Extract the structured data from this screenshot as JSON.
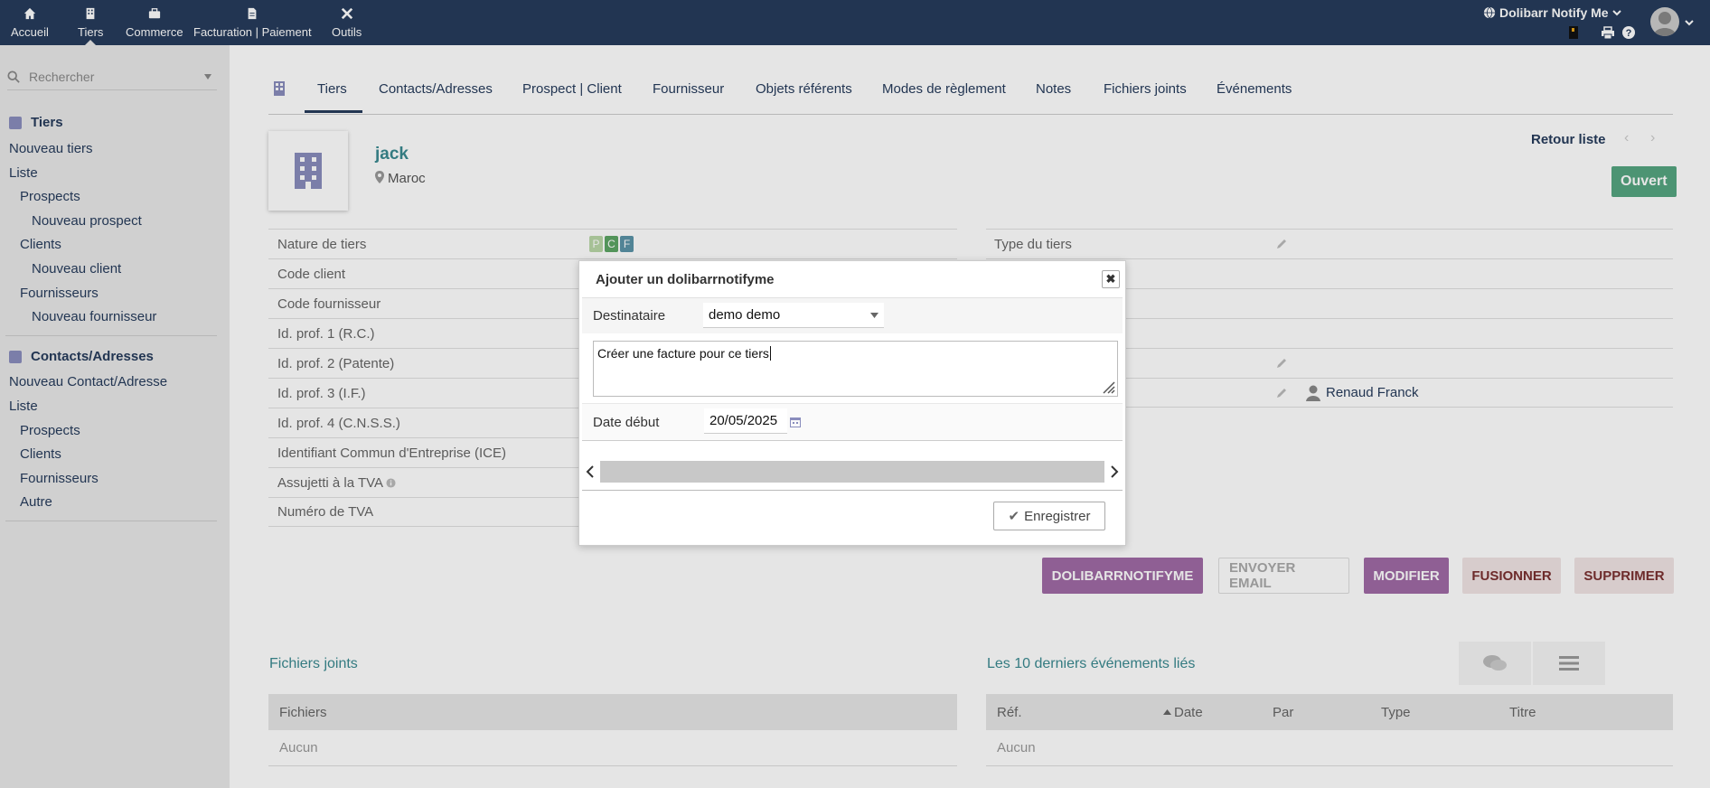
{
  "topnav": {
    "items": [
      {
        "label": "Accueil",
        "icon": "home-icon"
      },
      {
        "label": "Tiers",
        "icon": "building-icon"
      },
      {
        "label": "Commerce",
        "icon": "briefcase-icon"
      },
      {
        "label": "Facturation | Paiement",
        "icon": "invoice-icon"
      },
      {
        "label": "Outils",
        "icon": "tools-icon"
      }
    ],
    "brand": "Dolibarr Notify Me",
    "icons": [
      "notebook-icon",
      "print-icon",
      "help-icon",
      "chevron-down-icon"
    ]
  },
  "sidebar": {
    "search_placeholder": "Rechercher",
    "section1": "Tiers",
    "section1_items": [
      "Nouveau tiers",
      "Liste",
      "Prospects",
      "Nouveau prospect",
      "Clients",
      "Nouveau client",
      "Fournisseurs",
      "Nouveau fournisseur"
    ],
    "section2": "Contacts/Adresses",
    "section2_items": [
      "Nouveau Contact/Adresse",
      "Liste",
      "Prospects",
      "Clients",
      "Fournisseurs",
      "Autre"
    ]
  },
  "tabs": [
    "Tiers",
    "Contacts/Adresses",
    "Prospect | Client",
    "Fournisseur",
    "Objets référents",
    "Modes de règlement",
    "Notes",
    "Fichiers joints",
    "Événements"
  ],
  "company": {
    "name": "jack",
    "country": "Maroc",
    "back_link": "Retour liste",
    "status": "Ouvert"
  },
  "fields_left": [
    "Nature de tiers",
    "Code client",
    "Code fournisseur",
    "Id. prof. 1 (R.C.)",
    "Id. prof. 2 (Patente)",
    "Id. prof. 3 (I.F.)",
    "Id. prof. 4 (C.N.S.S.)",
    "Identifiant Commun d'Entreprise (ICE)",
    "Assujetti à la TVA",
    "Numéro de TVA"
  ],
  "nature_badges": [
    "P",
    "C",
    "F"
  ],
  "fields_right": {
    "type_label": "Type du tiers",
    "sales_rep": "Renaud Franck"
  },
  "colors": {
    "topbar": "#263c5c",
    "accent": "#3a8a90",
    "status": "#55a580",
    "purple": "#a06aa5"
  },
  "actions": [
    "DOLIBARRNOTIFYME",
    "ENVOYER EMAIL",
    "MODIFIER",
    "FUSIONNER",
    "SUPPRIMER"
  ],
  "files_section": {
    "title": "Fichiers joints",
    "header": "Fichiers",
    "empty": "Aucun"
  },
  "events_section": {
    "title": "Les 10 derniers événements liés",
    "columns": [
      "Réf.",
      "Date",
      "Par",
      "Type",
      "Titre"
    ],
    "empty": "Aucun"
  },
  "dialog": {
    "title": "Ajouter un dolibarrnotifyme",
    "recipient_label": "Destinataire",
    "recipient_value": "demo demo",
    "message": "Créer une facture pour ce tiers",
    "date_label": "Date début",
    "date_value": "20/05/2025",
    "save_label": "Enregistrer"
  }
}
